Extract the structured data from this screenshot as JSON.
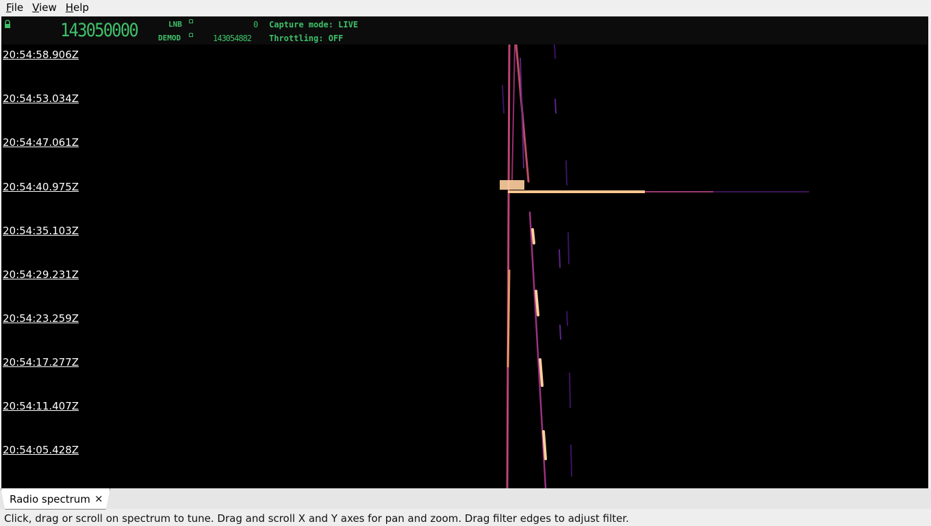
{
  "menu": {
    "file": {
      "mnemonic": "F",
      "rest": "ile"
    },
    "view": {
      "mnemonic": "V",
      "rest": "iew"
    },
    "help": {
      "mnemonic": "H",
      "rest": "elp"
    }
  },
  "header": {
    "frequency": "143050000",
    "lnb_label": "LNB",
    "lnb_value": "0",
    "demod_label": "DEMOD",
    "demod_value": "143054882",
    "capture_mode": "Capture mode: LIVE",
    "throttling": "Throttling: OFF"
  },
  "waterfall": {
    "timestamps": [
      "20:54:58.906Z",
      "20:54:53.034Z",
      "20:54:47.061Z",
      "20:54:40.975Z",
      "20:54:35.103Z",
      "20:54:29.231Z",
      "20:54:23.259Z",
      "20:54:17.277Z",
      "20:54:11.407Z",
      "20:54:05.428Z"
    ]
  },
  "tab": {
    "label": "Radio spectrum",
    "close_glyph": "×"
  },
  "status": "Click, drag or scroll on spectrum to tune. Drag and scroll X and Y axes for pan and zoom. Drag filter edges to adjust filter.",
  "colors": {
    "lcd_green": "#3ec06a",
    "hot": "#ffd0a0",
    "mid": "#e0508a",
    "cool": "#5a1e8c"
  }
}
